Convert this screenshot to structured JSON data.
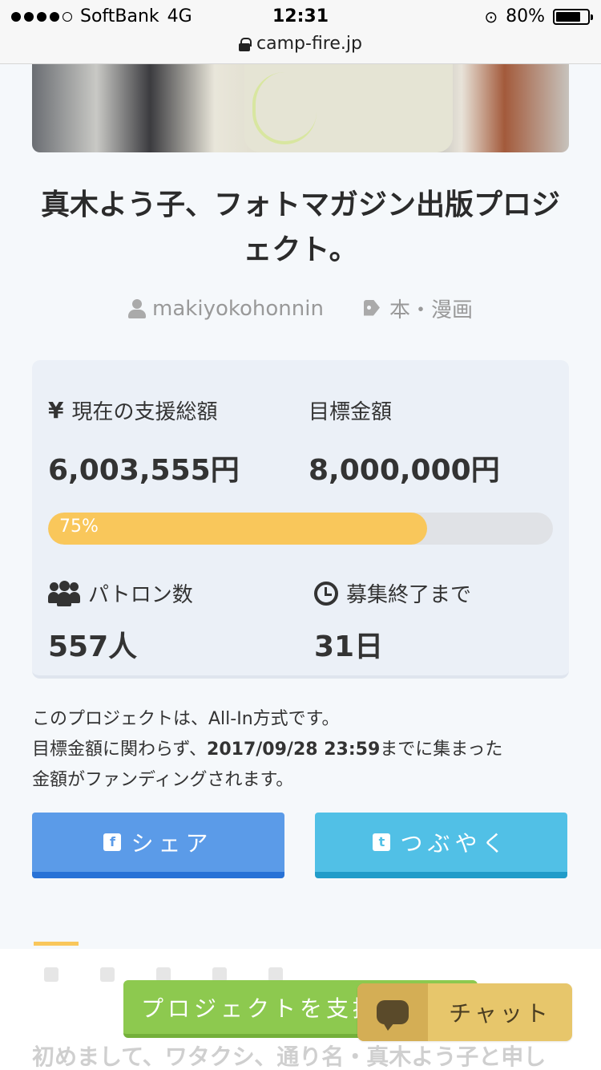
{
  "status_bar": {
    "carrier": "SoftBank",
    "network": "4G",
    "time": "12:31",
    "battery": "80%",
    "url": "camp-fire.jp"
  },
  "project": {
    "title": "真木よう子、フォトマガジン出版プロジェクト。",
    "owner": "makiyokohonnin",
    "category": "本・漫画"
  },
  "stats": {
    "current_label": "現在の支援総額",
    "current_value": "6,003,555円",
    "goal_label": "目標金額",
    "goal_value": "8,000,000円",
    "progress_percent": 75,
    "progress_label": "75%",
    "patrons_label": "パトロン数",
    "patrons_value": "557人",
    "remaining_label": "募集終了まで",
    "remaining_value": "31日"
  },
  "notice": {
    "line1": "このプロジェクトは、All-In方式です。",
    "line2_pre": "目標金額に関わらず、",
    "deadline": "2017/09/28 23:59",
    "line2_post": "までに集まった",
    "line3": "金額がファンディングされます。"
  },
  "share": {
    "facebook": "シェア",
    "twitter": "つぶやく"
  },
  "bottom": {
    "support_button": "プロジェクトを支援",
    "chat_button": "チャット",
    "body_preview": "初めまして、ワタクシ、通り名・真木よう子と申し"
  },
  "colors": {
    "progress": "#f9c75b",
    "facebook": "#5b9be8",
    "twitter": "#51c0e6",
    "support": "#8dc94f",
    "chat": "#e7c66b"
  }
}
